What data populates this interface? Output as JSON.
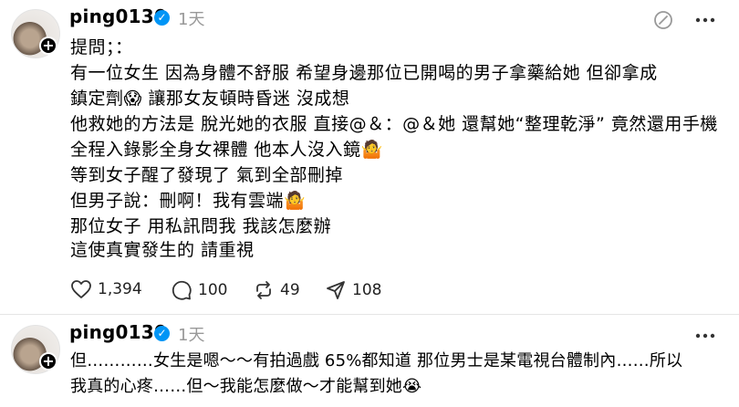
{
  "post1": {
    "username": "ping0130",
    "time": "1天",
    "lines": [
      "提問；：",
      "有一位女生 因為身體不舒服 希望身邊那位已開喝的男子拿藥給她 但卻拿成",
      "鎮定劑😱 讓那女友頓時昏迷 沒成想",
      "他救她的方法是 脫光她的衣服 直接@＆：@＆她 還幫她“整理乾淨” 竟然還用手機",
      "全程入錄影全身女裸體 他本人沒入鏡🤷",
      "等到女子醒了發現了 氣到全部刪掉",
      "但男子說：刪啊！我有雲端🤷",
      "那位女子 用私訊問我 我該怎麼辦",
      "這使真實發生的 請重視"
    ],
    "actions": {
      "likes": "1,394",
      "comments": "100",
      "reposts": "49",
      "shares": "108"
    }
  },
  "post2": {
    "username": "ping0130",
    "time": "1天",
    "lines": [
      "但…………女生是嗯～～有拍過戲 65%都知道 那位男士是某電視台體制內……所以",
      "我真的心疼……但～我能怎麼做～才能幫到她😭"
    ]
  },
  "icons": {
    "verified": "verified-badge-icon",
    "more": "more-icon",
    "translate": "translate-icon",
    "like": "heart-icon",
    "comment": "comment-icon",
    "repost": "repost-icon",
    "share": "send-icon",
    "follow": "plus-icon"
  },
  "colors": {
    "verified": "#0095f6",
    "muted": "#999999"
  }
}
